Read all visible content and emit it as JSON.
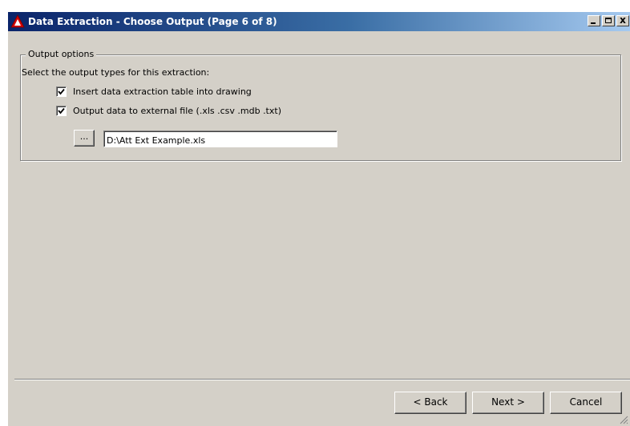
{
  "window": {
    "title": "Data Extraction - Choose Output (Page 6 of 8)",
    "minimize_glyph": "_",
    "close_glyph": "x"
  },
  "output_options": {
    "legend": "Output options",
    "description": "Select the output types for this extraction:",
    "insert_table": {
      "label": "Insert data extraction table into drawing",
      "checked": true
    },
    "external_file": {
      "label": "Output data to external file (.xls .csv .mdb .txt)",
      "checked": true
    },
    "browse_label": "...",
    "file_path": "D:\\Att Ext Example.xls"
  },
  "footer": {
    "back_label": "< Back",
    "next_label": "Next >",
    "cancel_label": "Cancel"
  },
  "icons": {
    "app": "autocad-app-icon",
    "check": "check-icon",
    "grip": "resize-grip-icon"
  },
  "colors": {
    "title_gradient_start": "#0a246a",
    "title_gradient_end": "#a6caf0",
    "face": "#d4d0c8"
  }
}
